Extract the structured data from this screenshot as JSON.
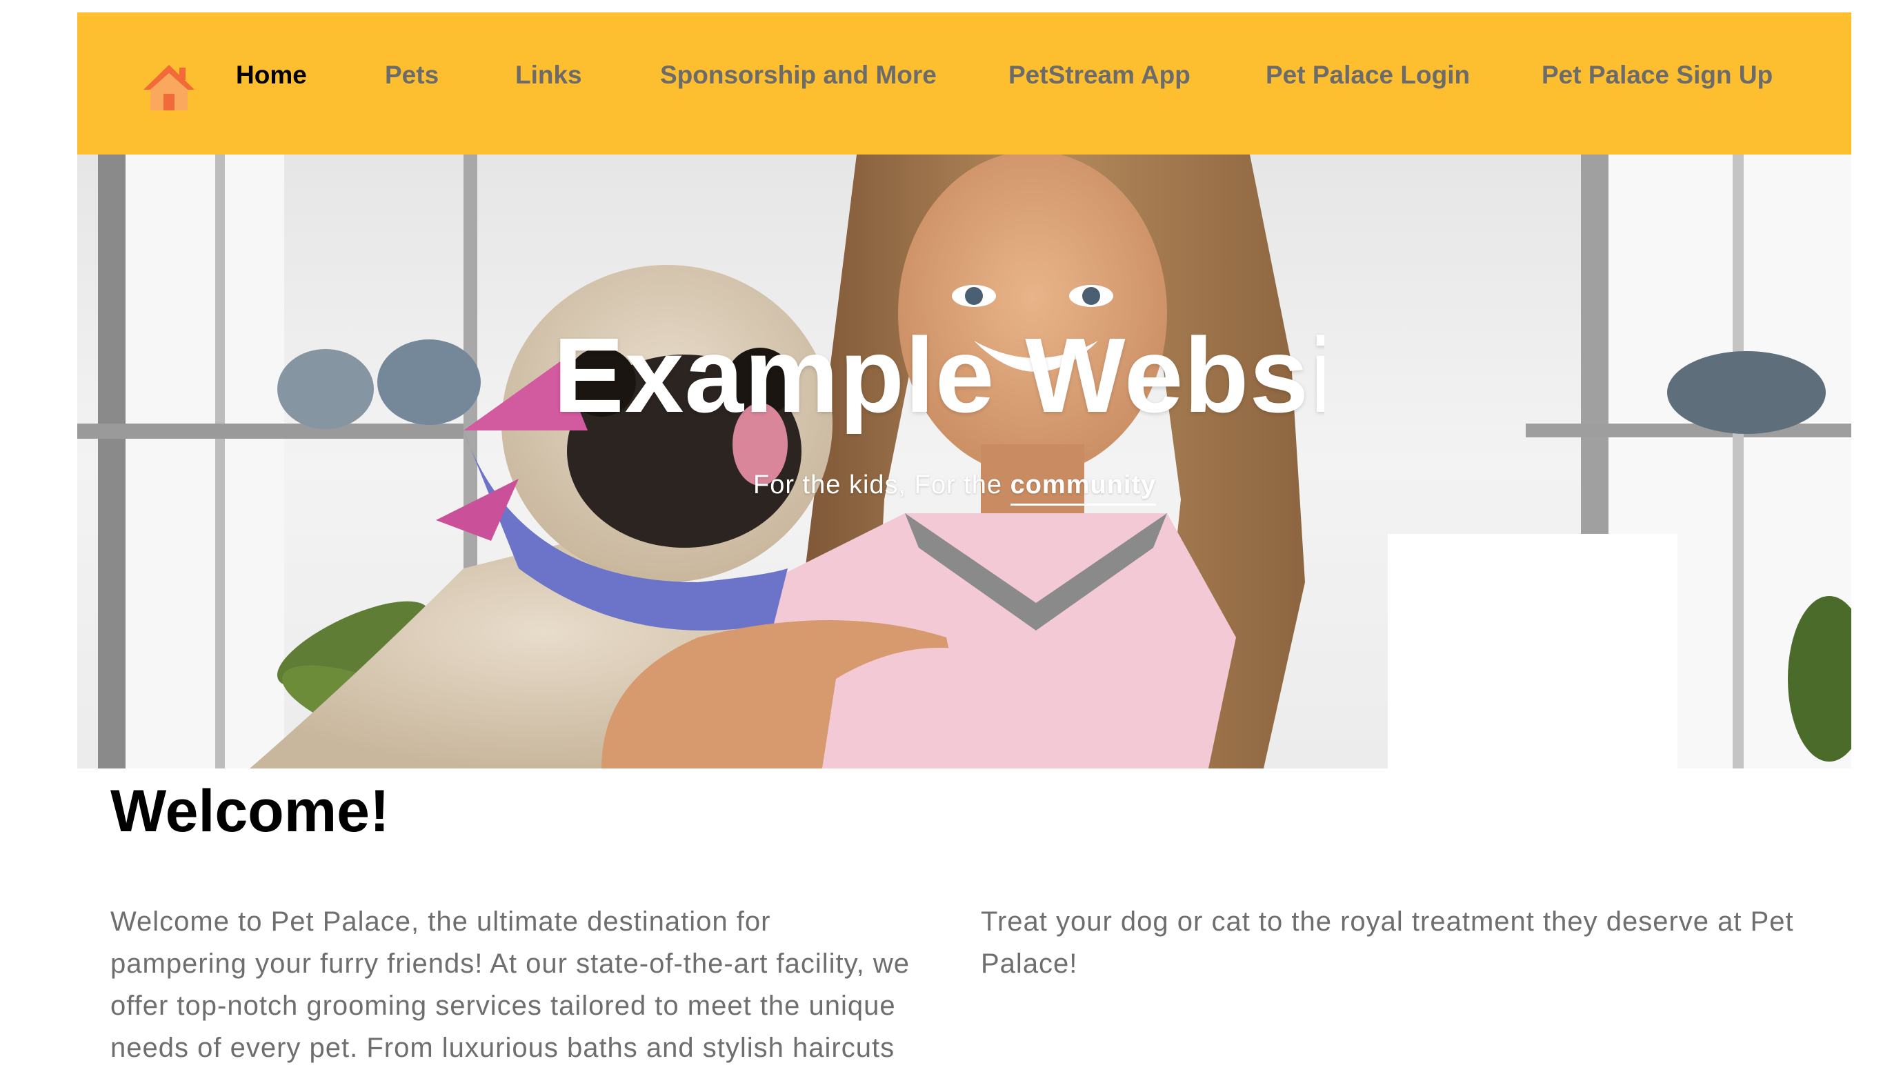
{
  "nav": {
    "logo_icon": "house-icon",
    "items": [
      {
        "label": "Home",
        "active": true
      },
      {
        "label": "Pets",
        "active": false
      },
      {
        "label": "Links",
        "active": false
      },
      {
        "label": "Sponsorship and More",
        "active": false
      },
      {
        "label": "PetStream App",
        "active": false
      },
      {
        "label": "Pet Palace Login",
        "active": false
      },
      {
        "label": "Pet Palace Sign Up",
        "active": false
      }
    ]
  },
  "hero": {
    "title": "Example Website",
    "subtitle_prefix": "For the kids, For the ",
    "subtitle_link": "community"
  },
  "main": {
    "heading": "Welcome!",
    "left_paragraph": "Welcome to Pet Palace, the ultimate destination for pampering your furry friends! At our state-of-the-art facility, we offer top-notch grooming services tailored to meet the unique needs of every pet. From luxurious baths and stylish haircuts to nail trims and more, our skilled team ensures every pet feels like royalty.",
    "right_paragraph": "Treat your dog or cat to the royal treatment they deserve at Pet Palace!"
  },
  "colors": {
    "nav_background": "#fdbf2f",
    "nav_text": "#6b6b6b",
    "nav_active": "#000000",
    "body_text": "#6e6e6e",
    "logo_orange": "#f26a3a",
    "logo_light": "#f9a85d"
  }
}
